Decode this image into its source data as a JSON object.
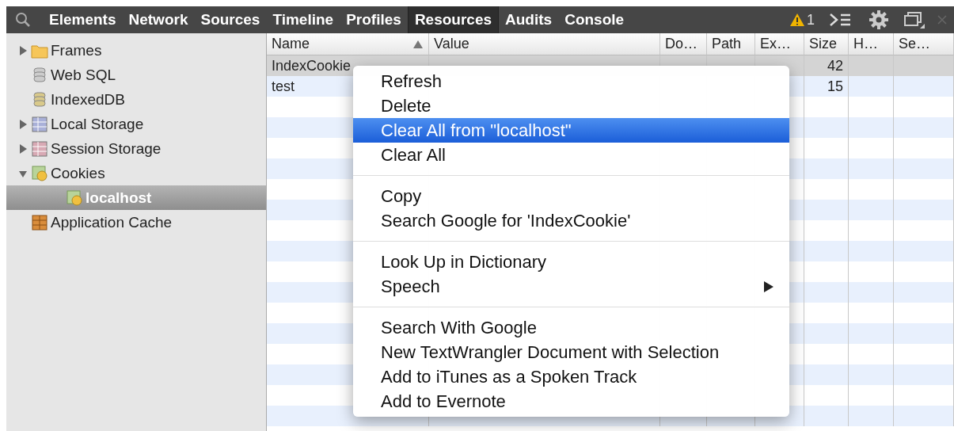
{
  "toolbar": {
    "tabs": [
      {
        "label": "Elements",
        "selected": false
      },
      {
        "label": "Network",
        "selected": false
      },
      {
        "label": "Sources",
        "selected": false
      },
      {
        "label": "Timeline",
        "selected": false
      },
      {
        "label": "Profiles",
        "selected": false
      },
      {
        "label": "Resources",
        "selected": true
      },
      {
        "label": "Audits",
        "selected": false
      },
      {
        "label": "Console",
        "selected": false
      }
    ],
    "warning_count": "1"
  },
  "sidebar": {
    "items": [
      {
        "label": "Frames",
        "kind": "folder",
        "expanded": false,
        "selected": false
      },
      {
        "label": "Web SQL",
        "kind": "database",
        "selected": false
      },
      {
        "label": "IndexedDB",
        "kind": "indexeddb",
        "selected": false
      },
      {
        "label": "Local Storage",
        "kind": "local",
        "expanded": false,
        "selected": false
      },
      {
        "label": "Session Storage",
        "kind": "session",
        "expanded": false,
        "selected": false
      },
      {
        "label": "Cookies",
        "kind": "cookie",
        "expanded": true,
        "selected": false,
        "children": [
          {
            "label": "localhost",
            "kind": "cookie",
            "selected": true
          }
        ]
      },
      {
        "label": "Application Cache",
        "kind": "appcache",
        "selected": false
      }
    ]
  },
  "table": {
    "columns": [
      {
        "label": "Name",
        "sorted": true
      },
      {
        "label": "Value",
        "sorted": false
      },
      {
        "label": "Do…",
        "sorted": false
      },
      {
        "label": "Path",
        "sorted": false
      },
      {
        "label": "Ex…",
        "sorted": false
      },
      {
        "label": "Size",
        "sorted": false
      },
      {
        "label": "H…",
        "sorted": false
      },
      {
        "label": "Se…",
        "sorted": false
      }
    ],
    "rows": [
      {
        "selected": true,
        "cells": [
          "IndexCookie",
          "",
          "",
          "",
          "",
          "42",
          "",
          ""
        ]
      },
      {
        "selected": false,
        "cells": [
          "test",
          "",
          "",
          "",
          "",
          "15",
          "",
          ""
        ]
      }
    ]
  },
  "context_menu": {
    "groups": [
      [
        {
          "label": "Refresh",
          "selected": false,
          "submenu": false
        },
        {
          "label": "Delete",
          "selected": false,
          "submenu": false
        },
        {
          "label": "Clear All from \"localhost\"",
          "selected": true,
          "submenu": false
        },
        {
          "label": "Clear All",
          "selected": false,
          "submenu": false
        }
      ],
      [
        {
          "label": "Copy",
          "selected": false,
          "submenu": false
        },
        {
          "label": "Search Google for 'IndexCookie'",
          "selected": false,
          "submenu": false
        }
      ],
      [
        {
          "label": "Look Up in Dictionary",
          "selected": false,
          "submenu": false
        },
        {
          "label": "Speech",
          "selected": false,
          "submenu": true
        }
      ],
      [
        {
          "label": "Search With Google",
          "selected": false,
          "submenu": false
        },
        {
          "label": "New TextWrangler Document with Selection",
          "selected": false,
          "submenu": false
        },
        {
          "label": "Add to iTunes as a Spoken Track",
          "selected": false,
          "submenu": false
        },
        {
          "label": "Add to Evernote",
          "selected": false,
          "submenu": false
        }
      ]
    ]
  }
}
